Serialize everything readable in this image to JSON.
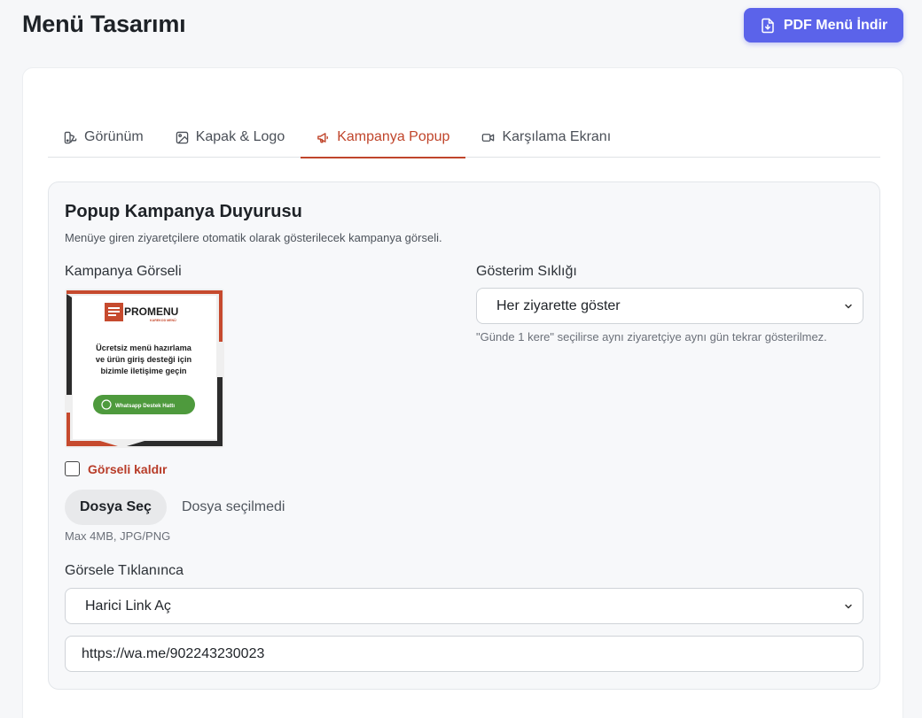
{
  "header": {
    "title": "Menü Tasarımı",
    "pdf_button": "PDF Menü İndir"
  },
  "tabs": [
    {
      "label": "Görünüm",
      "icon": "palette-icon",
      "active": false
    },
    {
      "label": "Kapak & Logo",
      "icon": "image-icon",
      "active": false
    },
    {
      "label": "Kampanya Popup",
      "icon": "megaphone-icon",
      "active": true
    },
    {
      "label": "Karşılama Ekranı",
      "icon": "video-icon",
      "active": false
    }
  ],
  "panel": {
    "title": "Popup Kampanya Duyurusu",
    "description": "Menüye giren ziyaretçilere otomatik olarak gösterilecek kampanya görseli.",
    "image_label": "Kampanya Görseli",
    "image": {
      "brand": "PROMENU",
      "brand_sub": "KAREKOD MENÜ",
      "headline": [
        "Ücretsiz menü hazırlama",
        "ve ürün giriş desteği için",
        "bizimle iletişime geçin"
      ],
      "cta": "Whatsapp Destek Hattı"
    },
    "remove_image_label": "Görseli kaldır",
    "file_button": "Dosya Seç",
    "file_status": "Dosya seçilmedi",
    "file_hint": "Max 4MB, JPG/PNG",
    "frequency_label": "Gösterim Sıklığı",
    "frequency_value": "Her ziyarette göster",
    "frequency_hint": "\"Günde 1 kere\" seçilirse aynı ziyaretçiye aynı gün tekrar gösterilmez.",
    "click_label": "Görsele Tıklanınca",
    "click_value": "Harici Link Aç",
    "link_value": "https://wa.me/902243230023"
  },
  "colors": {
    "accent": "#5b63ea",
    "active_tab": "#c0452b",
    "danger": "#b83c28",
    "whatsapp": "#4e9a3d"
  }
}
